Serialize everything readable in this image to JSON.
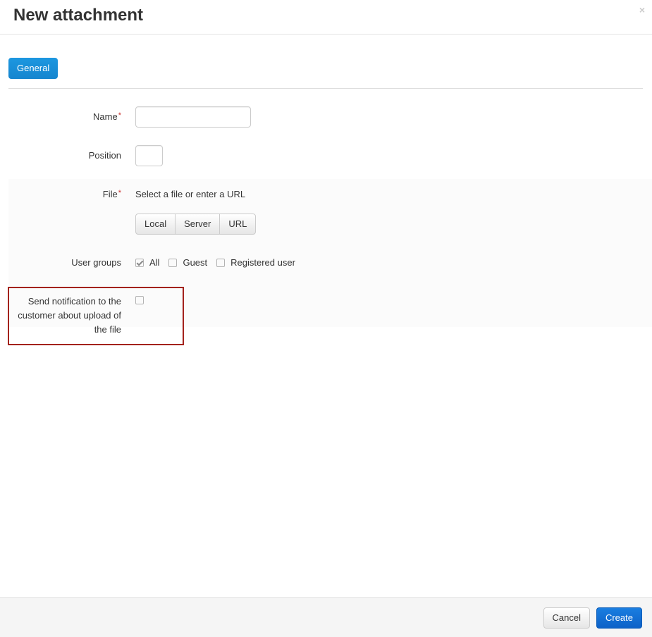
{
  "dialog": {
    "title": "New attachment",
    "close_glyph": "×"
  },
  "tabs": [
    {
      "label": "General",
      "active": true
    }
  ],
  "form": {
    "name": {
      "label": "Name",
      "required_mark": "*",
      "value": ""
    },
    "position": {
      "label": "Position",
      "value": ""
    },
    "file": {
      "label": "File",
      "required_mark": "*",
      "hint": "Select a file or enter a URL",
      "sources": [
        "Local",
        "Server",
        "URL"
      ]
    },
    "user_groups": {
      "label": "User groups",
      "options": [
        {
          "label": "All",
          "checked": true
        },
        {
          "label": "Guest",
          "checked": false
        },
        {
          "label": "Registered user",
          "checked": false
        }
      ]
    },
    "notification": {
      "label": "Send notification to the customer about upload of the file",
      "checked": false
    }
  },
  "footer": {
    "cancel_label": "Cancel",
    "create_label": "Create"
  },
  "colors": {
    "primary": "#1a8ed8",
    "create_button": "#0d62c8",
    "highlight_border": "#a3221c",
    "required": "#c9302c"
  }
}
